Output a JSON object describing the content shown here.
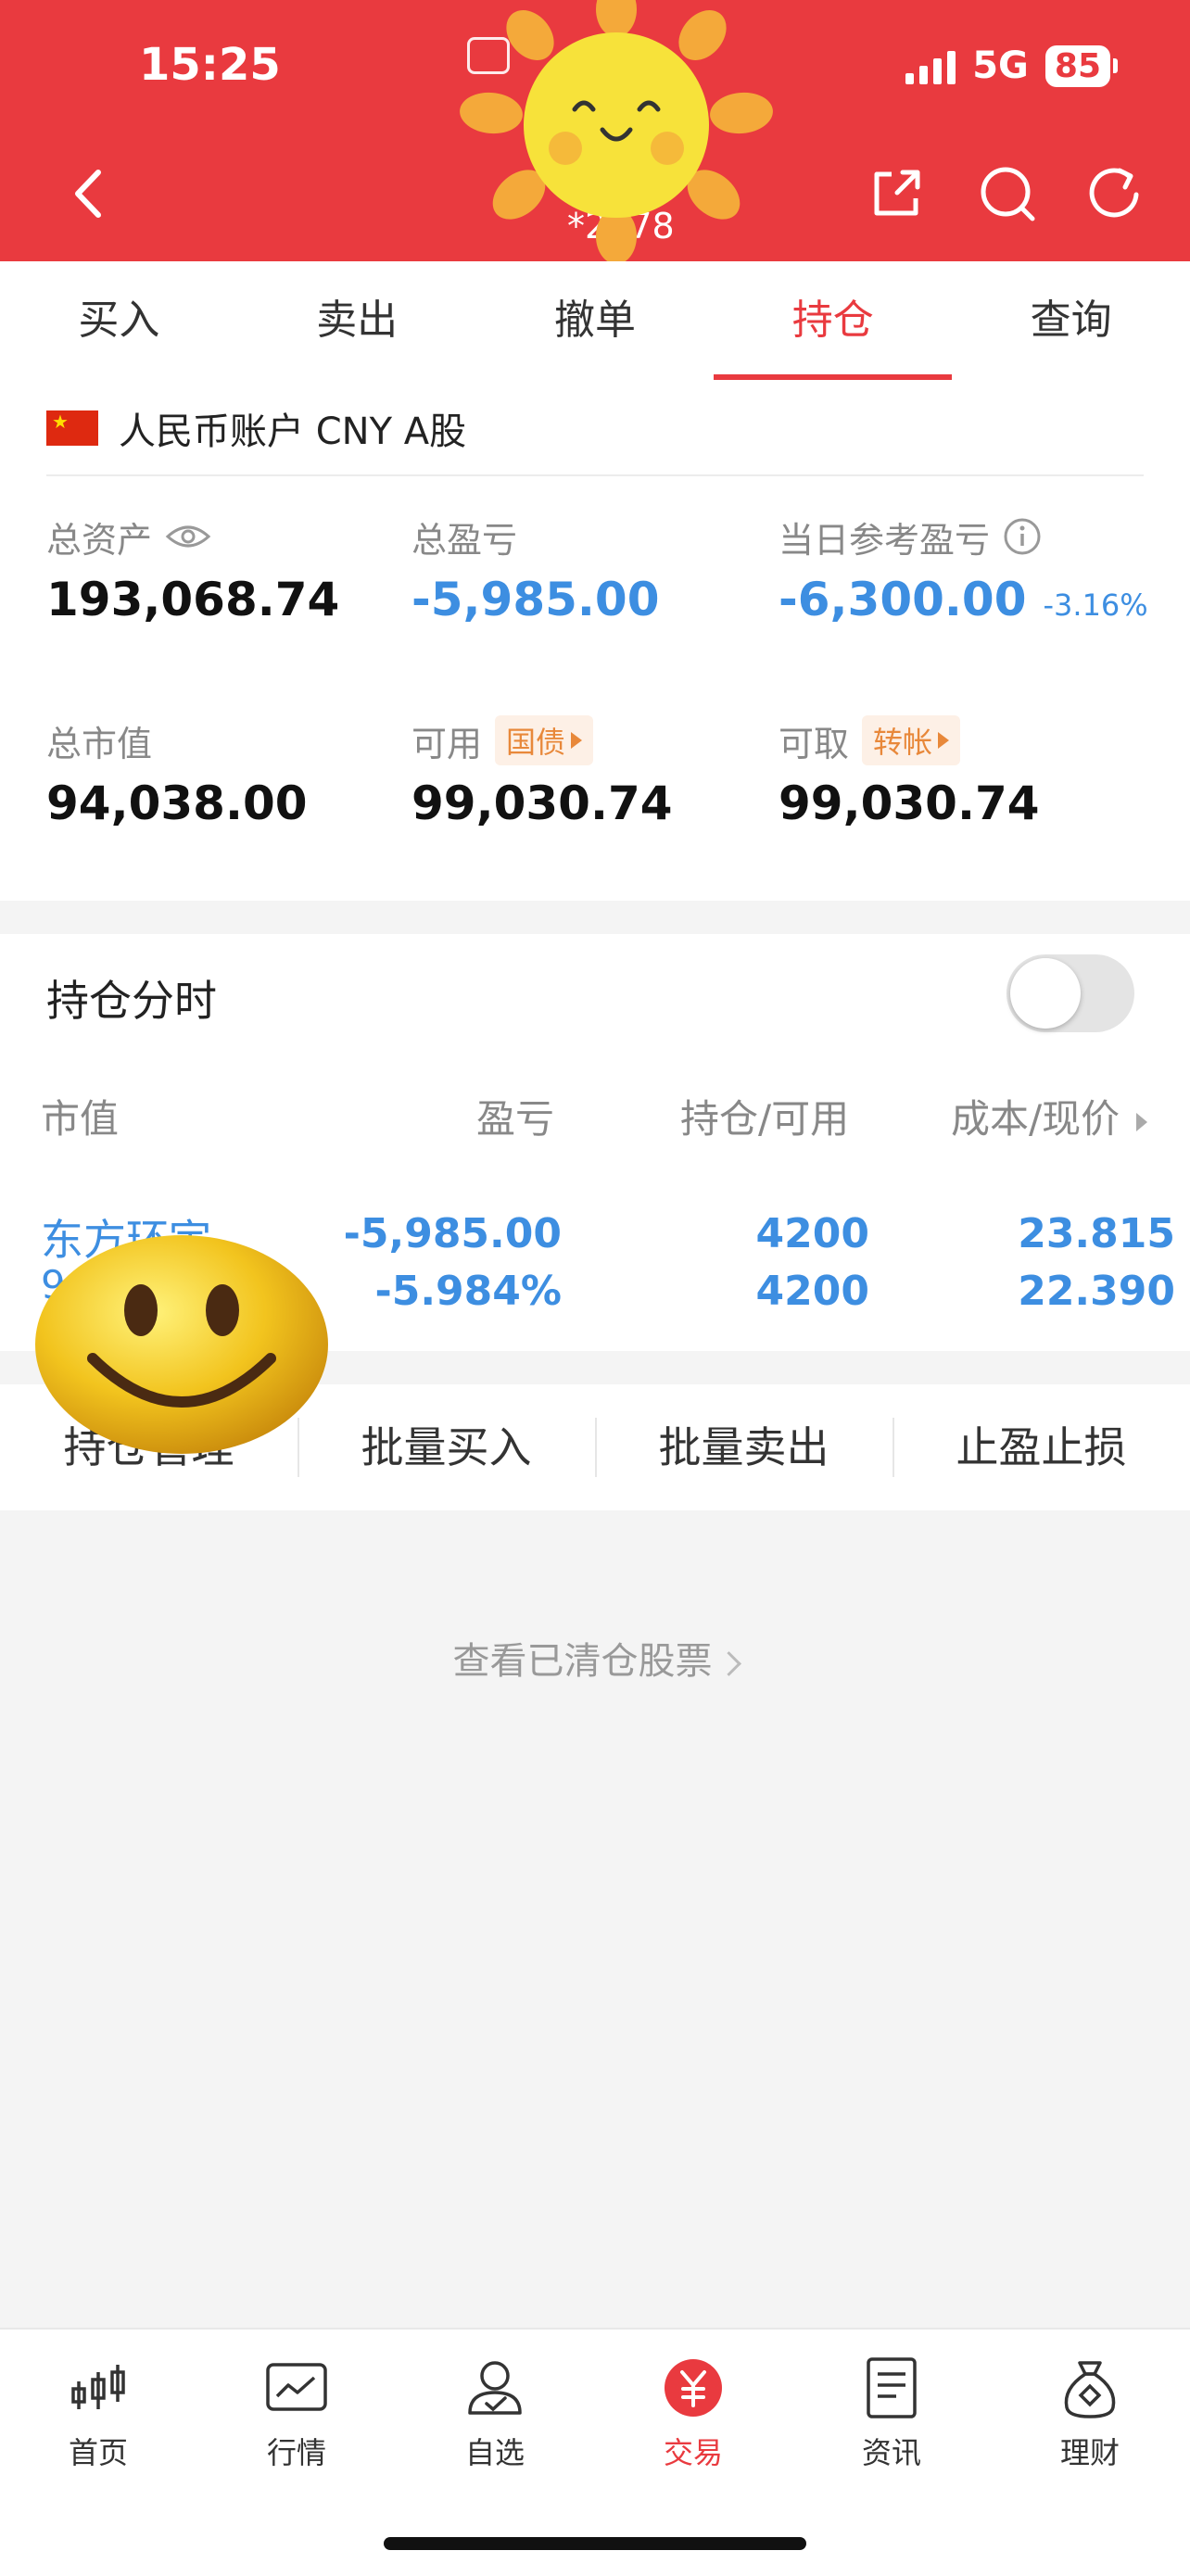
{
  "status": {
    "time": "15:25",
    "network": "5G",
    "battery": "85"
  },
  "header": {
    "account_sub": "*2978"
  },
  "tabs": [
    {
      "label": "买入"
    },
    {
      "label": "卖出"
    },
    {
      "label": "撤单"
    },
    {
      "label": "持仓",
      "active": true
    },
    {
      "label": "查询"
    }
  ],
  "account": {
    "label": "人民币账户 CNY A股"
  },
  "metrics": {
    "total_assets": {
      "label": "总资产",
      "value": "193,068.74"
    },
    "total_pnl": {
      "label": "总盈亏",
      "value": "-5,985.00"
    },
    "daily_pnl": {
      "label": "当日参考盈亏",
      "value": "-6,300.00",
      "pct": "-3.16%"
    },
    "market_value": {
      "label": "总市值",
      "value": "94,038.00"
    },
    "available": {
      "label": "可用",
      "badge": "国债",
      "value": "99,030.74"
    },
    "withdrawable": {
      "label": "可取",
      "badge": "转帐",
      "value": "99,030.74"
    }
  },
  "holding_toggle": {
    "label": "持仓分时",
    "on": false
  },
  "table": {
    "headers": [
      "市值",
      "盈亏",
      "持仓/可用",
      "成本/现价"
    ],
    "rows": [
      {
        "name": "东方环宇",
        "code": "9",
        "pnl": "-5,985.00",
        "pnl_pct": "-5.984%",
        "position": "4200",
        "available": "4200",
        "cost": "23.815",
        "price": "22.390"
      }
    ]
  },
  "actions": [
    "持仓管理",
    "批量买入",
    "批量卖出",
    "止盈止损"
  ],
  "cleared_link": "查看已清仓股票",
  "tabbar": [
    {
      "label": "首页",
      "icon": "candlestick-icon"
    },
    {
      "label": "行情",
      "icon": "chart-icon"
    },
    {
      "label": "自选",
      "icon": "user-check-icon"
    },
    {
      "label": "交易",
      "icon": "yuan-icon",
      "active": true
    },
    {
      "label": "资讯",
      "icon": "news-icon"
    },
    {
      "label": "理财",
      "icon": "money-bag-icon"
    }
  ],
  "colors": {
    "brand_red": "#e93a3f",
    "value_blue": "#3d8ee1",
    "badge_orange": "#e8883a"
  }
}
